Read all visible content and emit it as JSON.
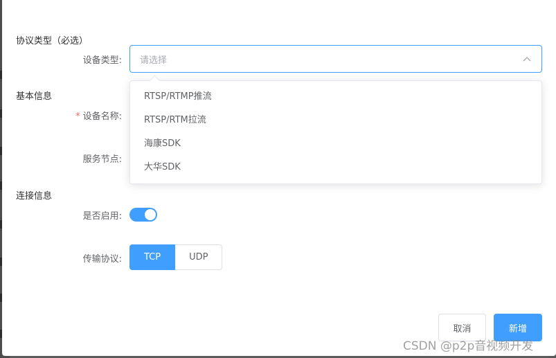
{
  "sections": {
    "protocol_type": "协议类型（必选）",
    "basic_info": "基本信息",
    "connection_info": "连接信息"
  },
  "fields": {
    "device_type_label": "设备类型:",
    "device_type_placeholder": "请选择",
    "device_name_label": "设备名称:",
    "service_node_label": "服务节点:",
    "enabled_label": "是否启用:",
    "transport_label": "传输协议:"
  },
  "dropdown": {
    "options": [
      "RTSP/RTMP推流",
      "RTSP/RTM拉流",
      "海康SDK",
      "大华SDK"
    ]
  },
  "switch": {
    "enabled": true
  },
  "transport": {
    "options": [
      "TCP",
      "UDP"
    ],
    "selected": "TCP"
  },
  "buttons": {
    "cancel": "取消",
    "add": "新增"
  },
  "watermark": "CSDN @p2p音视频开发",
  "icons": {
    "select_arrow": "chevron-up-icon"
  },
  "colors": {
    "primary": "#409eff",
    "required": "#f56c6c"
  }
}
